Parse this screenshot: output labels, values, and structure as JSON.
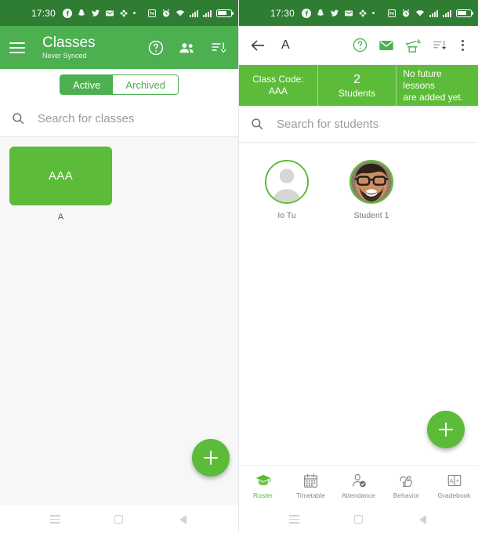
{
  "status_bar": {
    "time": "17:30",
    "icons": [
      "facebook-icon",
      "snapchat-icon",
      "twitter-icon",
      "email-icon",
      "sync-icon",
      "dot-icon",
      "nfc-icon",
      "alarm-icon",
      "wifi-icon",
      "signal-icon",
      "signal-icon-2",
      "battery-icon"
    ]
  },
  "left_panel": {
    "appbar": {
      "menu_icon": "hamburger-icon",
      "title": "Classes",
      "subtitle": "Never Synced",
      "actions": [
        "help-icon",
        "people-icon",
        "sort-icon"
      ]
    },
    "toggle": {
      "active_label": "Active",
      "archived_label": "Archived",
      "selected": "Active"
    },
    "search": {
      "icon": "search-icon",
      "placeholder": "Search for classes"
    },
    "classes": [
      {
        "code": "AAA",
        "label": "A"
      }
    ],
    "fab": {
      "icon": "plus-icon",
      "label": "Add class"
    }
  },
  "right_panel": {
    "appbar": {
      "back_icon": "back-arrow-icon",
      "title": "A",
      "actions": [
        "help-icon",
        "mail-icon",
        "magic-hat-icon",
        "sort-icon",
        "overflow-menu-icon"
      ]
    },
    "info": [
      {
        "line1": "Class Code:",
        "line2": "AAA"
      },
      {
        "line1": "2",
        "line2": "Students"
      },
      {
        "line1": "No future lessons",
        "line2": "are added yet."
      }
    ],
    "search": {
      "icon": "search-icon",
      "placeholder": "Search for students"
    },
    "students": [
      {
        "name": "Io Tu",
        "avatar": "placeholder-avatar"
      },
      {
        "name": "Student 1",
        "avatar": "photo-avatar"
      }
    ],
    "fab": {
      "icon": "plus-icon",
      "label": "Add student"
    },
    "bottom_nav": [
      {
        "label": "Roster",
        "icon": "graduation-cap-icon",
        "active": true
      },
      {
        "label": "Timetable",
        "icon": "calendar-icon",
        "active": false
      },
      {
        "label": "Attendance",
        "icon": "person-check-icon",
        "active": false
      },
      {
        "label": "Behavior",
        "icon": "thumbs-up-icon",
        "active": false
      },
      {
        "label": "Gradebook",
        "icon": "grade-a-plus-icon",
        "active": false
      }
    ]
  },
  "android_nav": {
    "recents": "recents-icon",
    "home": "home-icon",
    "back": "back-icon"
  },
  "colors": {
    "appbar_green": "#4CAF50",
    "status_green": "#2E7D32",
    "card_green": "#5CBB38",
    "text_gray": "#8a8a8a"
  }
}
